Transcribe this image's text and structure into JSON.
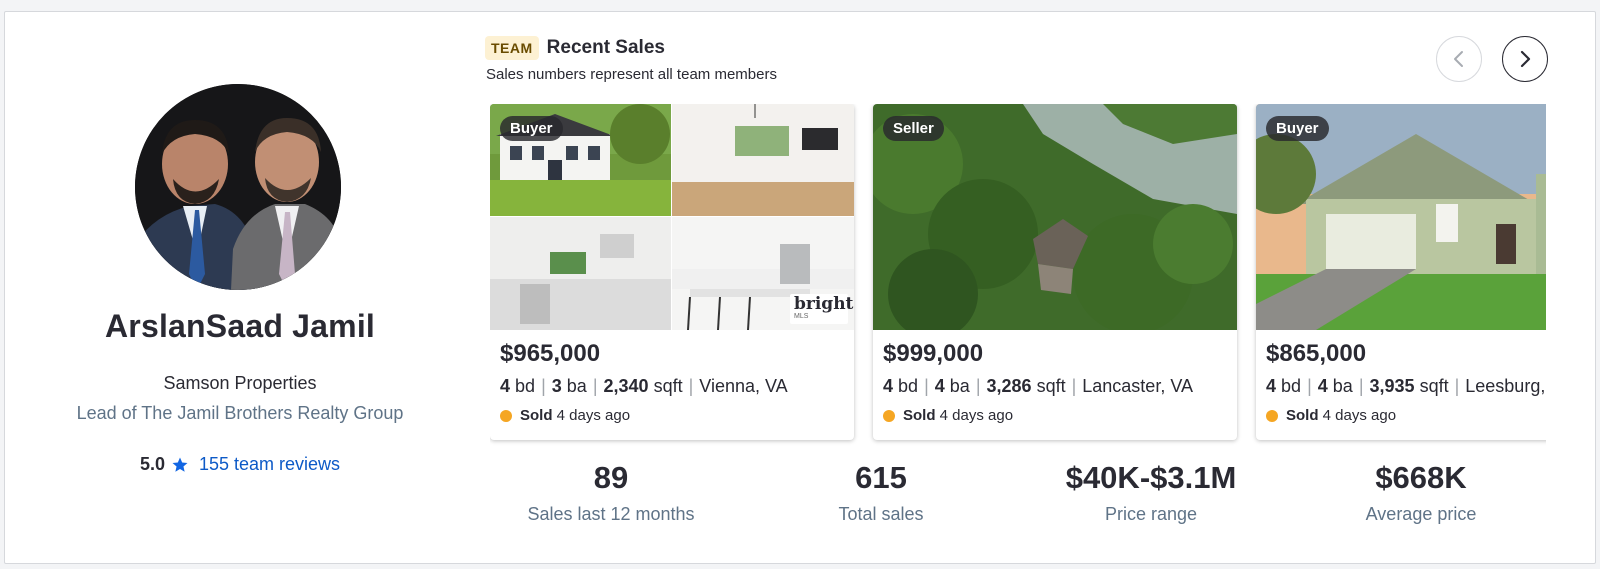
{
  "agent": {
    "name": "ArslanSaad Jamil",
    "brokerage": "Samson Properties",
    "role": "Lead of The Jamil Brothers Realty Group",
    "rating": "5.0",
    "reviews_link": "155 team reviews"
  },
  "sales": {
    "badge": "TEAM",
    "title": "Recent Sales",
    "subtitle": "Sales numbers represent all team members",
    "listings": [
      {
        "role": "Buyer",
        "price": "$965,000",
        "beds": "4",
        "beds_unit": "bd",
        "baths": "3",
        "baths_unit": "ba",
        "sqft": "2,340",
        "sqft_unit": "sqft",
        "location": "Vienna, VA",
        "status": "Sold",
        "when": "4 days ago",
        "mls_logo": "bright",
        "mls_sub": "MLS"
      },
      {
        "role": "Seller",
        "price": "$999,000",
        "beds": "4",
        "beds_unit": "bd",
        "baths": "4",
        "baths_unit": "ba",
        "sqft": "3,286",
        "sqft_unit": "sqft",
        "location": "Lancaster, VA",
        "status": "Sold",
        "when": "4 days ago"
      },
      {
        "role": "Buyer",
        "price": "$865,000",
        "beds": "4",
        "beds_unit": "bd",
        "baths": "4",
        "baths_unit": "ba",
        "sqft": "3,935",
        "sqft_unit": "sqft",
        "location": "Leesburg, VA",
        "status": "Sold",
        "when": "4 days ago"
      }
    ]
  },
  "stats": [
    {
      "value": "89",
      "label": "Sales last 12 months"
    },
    {
      "value": "615",
      "label": "Total sales"
    },
    {
      "value": "$40K-$3.1M",
      "label": "Price range"
    },
    {
      "value": "$668K",
      "label": "Average price"
    }
  ],
  "colors": {
    "accent_link": "#0d5ac7",
    "star": "#1266e3",
    "sold_dot": "#f5a623",
    "badge_bg": "#fdf1d3"
  },
  "icons": {
    "prev": "chevron-left-icon",
    "next": "chevron-right-icon",
    "rating": "star-icon"
  }
}
